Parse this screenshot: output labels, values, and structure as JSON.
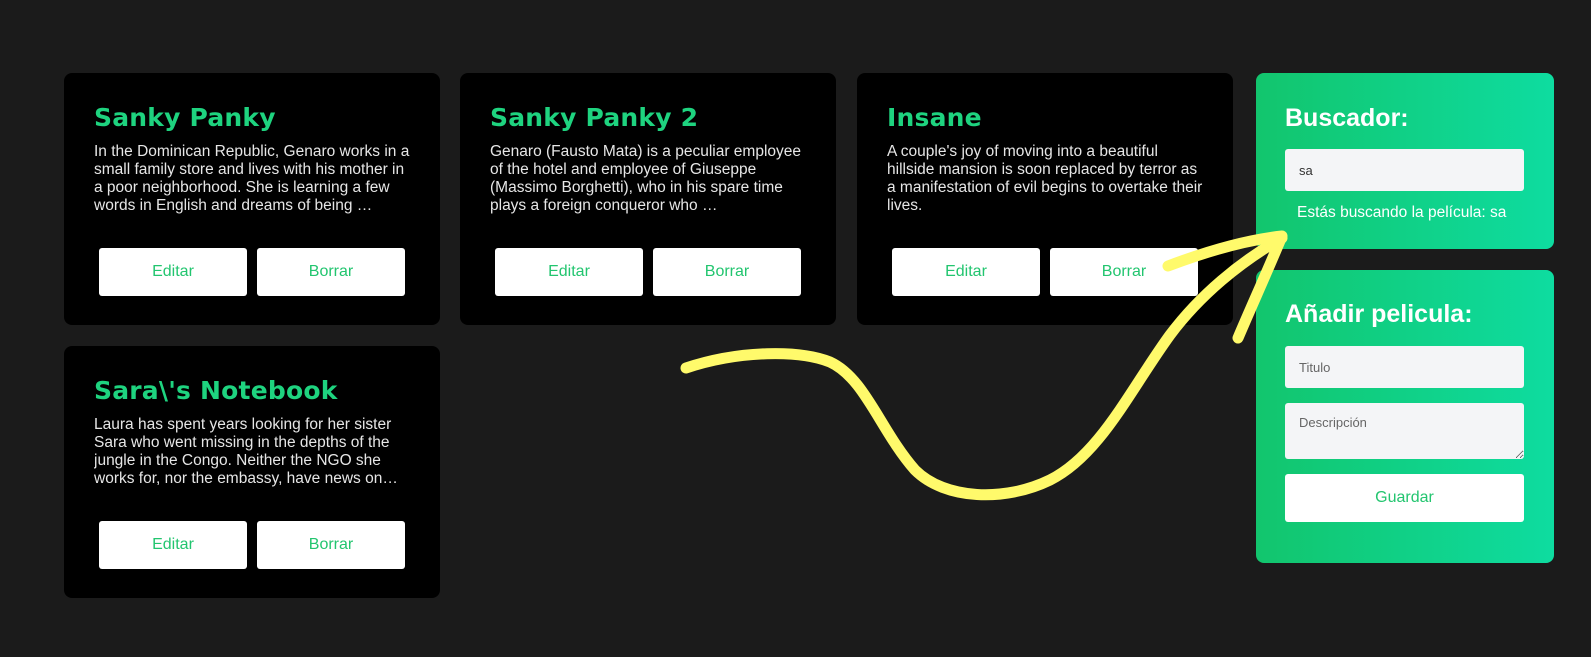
{
  "movies": [
    {
      "title": "Sanky Panky",
      "description": "In the Dominican Republic, Genaro works in a small family store and lives with his mother in a poor neighborhood. She is learning a few words in English and dreams of being …",
      "edit_label": "Editar",
      "delete_label": "Borrar"
    },
    {
      "title": "Sanky Panky 2",
      "description": "Genaro (Fausto Mata) is a peculiar employee of the hotel and employee of Giuseppe (Massimo Borghetti), who in his spare time plays a foreign conqueror who …",
      "edit_label": "Editar",
      "delete_label": "Borrar"
    },
    {
      "title": "Insane",
      "description": "A couple's joy of moving into a beautiful hillside mansion is soon replaced by terror as a manifestation of evil begins to overtake their lives.",
      "edit_label": "Editar",
      "delete_label": "Borrar"
    },
    {
      "title": "Sara\\'s Notebook",
      "description": "Laura has spent years looking for her sister Sara who went missing in the depths of the jungle in the Congo. Neither the NGO she works for, nor the embassy, have news on…",
      "edit_label": "Editar",
      "delete_label": "Borrar"
    }
  ],
  "search": {
    "title": "Buscador:",
    "value": "sa",
    "status": "Estás buscando la película: sa"
  },
  "add_movie": {
    "title": "Añadir pelicula:",
    "title_placeholder": "Titulo",
    "description_placeholder": "Descripción",
    "save_label": "Guardar"
  },
  "colors": {
    "background": "#1b1b1b",
    "card": "#000000",
    "accent": "#1ed37f",
    "panel_gradient_start": "#12c56d",
    "panel_gradient_end": "#0edca0",
    "annotation_arrow": "#fffa6b"
  },
  "annotation": {
    "icon": "hand-drawn-arrow-icon"
  }
}
